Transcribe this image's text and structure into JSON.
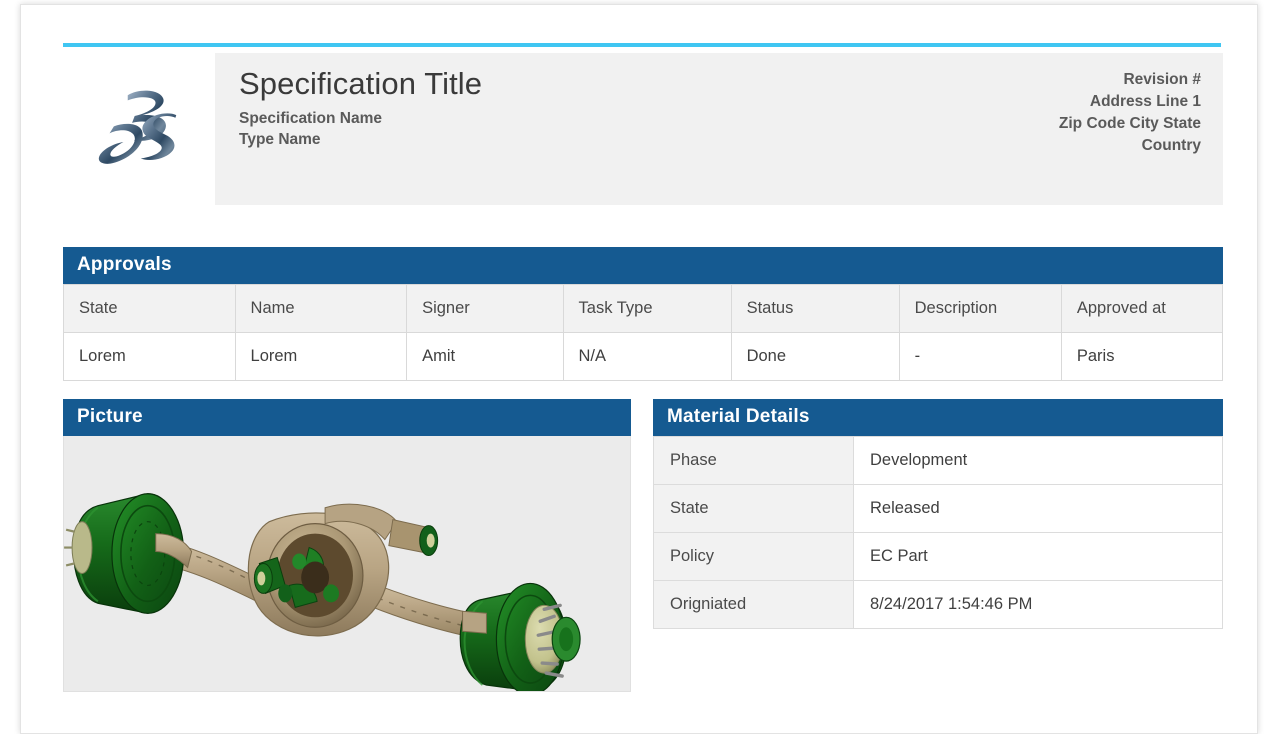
{
  "document": {
    "logo_alt": "3DS Dassault Systemes logo",
    "title": "Specification Title",
    "subtitle_name": "Specification Name",
    "subtitle_type": "Type Name",
    "address": {
      "line1": "Revision #",
      "line2": "Address Line 1",
      "line3": "Zip Code City State",
      "line4": "Country"
    }
  },
  "approvals": {
    "panel_title": "Approvals",
    "columns": [
      "State",
      "Name",
      "Signer",
      "Task Type",
      "Status",
      "Description",
      "Approved at"
    ],
    "rows": [
      [
        "Lorem",
        "Lorem",
        "Amit",
        "N/A",
        "Done",
        "-",
        "Paris"
      ]
    ]
  },
  "picture": {
    "panel_title": "Picture",
    "image_alt": "3D CAD rendering of a vehicle rear axle assembly with green brake drums and tan axle housing"
  },
  "material_details": {
    "panel_title": "Material Details",
    "rows": [
      {
        "label": "Phase",
        "value": "Development"
      },
      {
        "label": "State",
        "value": "Released"
      },
      {
        "label": "Policy",
        "value": "EC Part"
      },
      {
        "label": "Origniated",
        "value": "8/24/2017 1:54:46 PM"
      }
    ]
  },
  "colors": {
    "panel_header_blue": "#155a91",
    "accent_cyan": "#3fc6f2",
    "header_grey": "#f1f1f1",
    "drum_green": "#14631a",
    "housing_tan": "#bba88a"
  }
}
